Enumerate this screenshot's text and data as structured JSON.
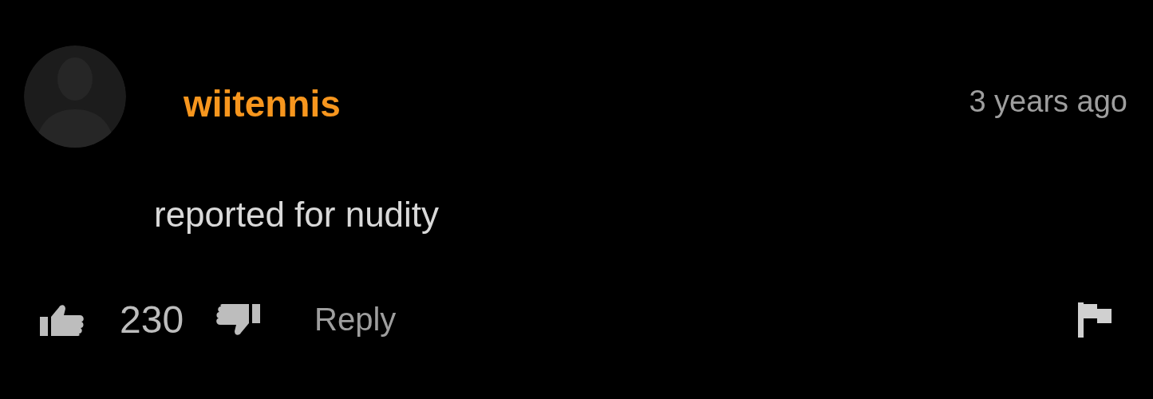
{
  "comment": {
    "username": "wiitennis",
    "time": "3 years ago",
    "text": "reported for nudity",
    "likes": "230",
    "reply": "Reply"
  }
}
